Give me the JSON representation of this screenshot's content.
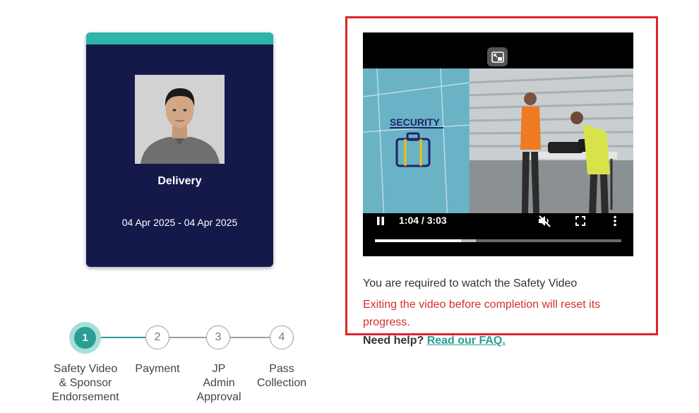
{
  "pass_card": {
    "role": "Delivery",
    "date_range": "04 Apr 2025 - 04 Apr 2025",
    "accent_color": "#2bb5ab",
    "background_color": "#15194a"
  },
  "stepper": {
    "steps": [
      {
        "number": "1",
        "label_lines": [
          "Safety Video",
          "& Sponsor",
          "Endorsement"
        ],
        "status": "active"
      },
      {
        "number": "2",
        "label_lines": [
          "Payment"
        ],
        "status": "pending"
      },
      {
        "number": "3",
        "label_lines": [
          "JP",
          "Admin",
          "Approval"
        ],
        "status": "pending"
      },
      {
        "number": "4",
        "label_lines": [
          "Pass",
          "Collection"
        ],
        "status": "pending"
      }
    ],
    "active_color": "#2a9d94"
  },
  "video": {
    "overlay_text": "SECURITY",
    "time_display": "1:04 / 3:03",
    "played_fraction": 0.35,
    "buffered_fraction": 0.41,
    "controls": {
      "play_pause_icon": "pause-icon",
      "mute_icon": "muted-icon",
      "fullscreen_icon": "fullscreen-icon",
      "more_icon": "more-vert-icon",
      "pip_icon": "picture-in-picture-icon"
    }
  },
  "messages": {
    "required": "You are required to watch the Safety Video",
    "warning": "Exiting the video before completion will reset its progress.",
    "help_prefix": "Need help?",
    "help_link": "Read our FAQ."
  },
  "highlight_color": "#e0232b"
}
